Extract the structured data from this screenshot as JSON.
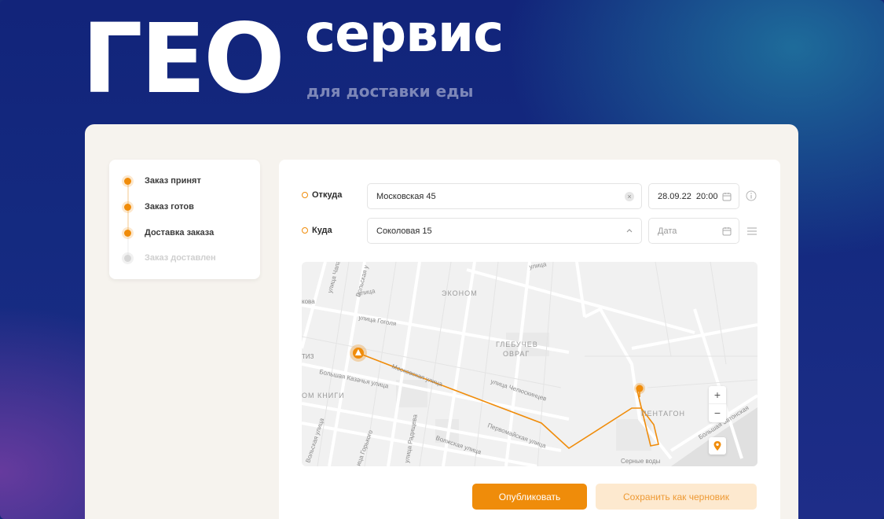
{
  "header": {
    "title_big": "ГЕО",
    "title_small": "сервис",
    "subtitle": "для доставки еды"
  },
  "steps": [
    {
      "label": "Заказ принят",
      "state": "done"
    },
    {
      "label": "Заказ готов",
      "state": "done"
    },
    {
      "label": "Доставка заказа",
      "state": "done"
    },
    {
      "label": "Заказ доставлен",
      "state": "pending"
    }
  ],
  "form": {
    "from_label": "Откуда",
    "from_value": "Московская 45",
    "from_datetime": "28.09.22  20:00",
    "to_label": "Куда",
    "to_value": "Соколовая 15",
    "to_date_placeholder": "Дата"
  },
  "map": {
    "labels": {
      "street_chapaeva": "улица Чапаева",
      "volskaya_top": "Вольская у",
      "street_top": "улица",
      "ekonom": "ЭКОНОМ",
      "street_gogolya": "улица Гоголя",
      "kova": "кова",
      "glebuchev1": "ГЛЕБУЧЕВ",
      "glebuchev2": "ОВРАГ",
      "tiz": "ТИЗ",
      "moskovskaya": "Московская улица",
      "kazachya": "Большая Казачья улица",
      "chelyuskintsev": "улица Челюскинцев",
      "domknigi": "ОМ КНИГИ",
      "pentagon": "ПЕНТАГОН",
      "zatonskaya": "Большая Затонская",
      "radishcheva": "улица Радищева",
      "pervomayskaya": "Первомайская улица",
      "volskaya_street": "Вольская улица",
      "volzhskaya": "Волжская улица",
      "gorkogo": "ица Горького",
      "volskaya_bottom": "Вольская улица",
      "sernye": "Серные воды"
    },
    "zoom_in": "+",
    "zoom_out": "−",
    "route_color": "#f08c0a"
  },
  "actions": {
    "publish": "Опубликовать",
    "save_draft": "Сохранить как черновик"
  },
  "colors": {
    "accent": "#f08c0a",
    "background": "#14297a",
    "panel": "#f6f3ee"
  }
}
